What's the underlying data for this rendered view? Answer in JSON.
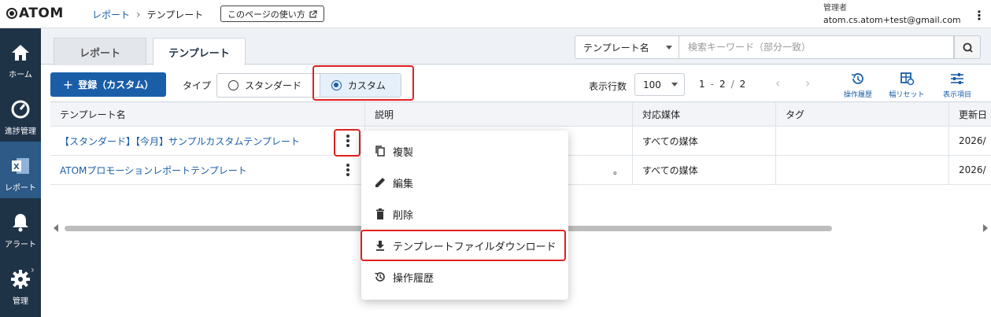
{
  "header": {
    "logo": "ATOM",
    "breadcrumb": [
      "レポート",
      "テンプレート"
    ],
    "help_button": "このページの使い方",
    "user_role": "管理者",
    "user_email": "atom.cs.atom+test@gmail.com"
  },
  "sidebar": {
    "items": [
      {
        "label": "ホーム",
        "icon": "home-icon"
      },
      {
        "label": "進捗管理",
        "icon": "gauge-icon"
      },
      {
        "label": "レポート",
        "icon": "excel-icon",
        "active": true
      },
      {
        "label": "アラート",
        "icon": "bell-icon"
      },
      {
        "label": "管理",
        "icon": "gear-icon"
      }
    ]
  },
  "tabs": [
    "レポート",
    "テンプレート"
  ],
  "search": {
    "field_select": "テンプレート名",
    "placeholder": "検索キーワード（部分一致）"
  },
  "toolbar": {
    "add_button": "登録（カスタム）",
    "type_label": "タイプ",
    "type_options": [
      "スタンダード",
      "カスタム"
    ],
    "selected_type": "カスタム",
    "rows_label": "表示行数",
    "rows_value": "100",
    "pager": {
      "from": "1",
      "to": "2",
      "total": "2"
    },
    "tools": [
      "操作履歴",
      "幅リセット",
      "表示項目"
    ]
  },
  "table": {
    "columns": [
      "テンプレート名",
      "説明",
      "対応媒体",
      "タグ",
      "更新日"
    ],
    "rows": [
      {
        "name": "【スタンダード】【今月】サンプルカスタムテンプレート",
        "desc": "",
        "media": "すべての媒体",
        "tag": "",
        "updated": "2026/"
      },
      {
        "name": "ATOMプロモーションレポートテンプレート",
        "desc": "。",
        "media": "すべての媒体",
        "tag": "",
        "updated": "2026/"
      }
    ]
  },
  "context_menu": {
    "items": [
      "複製",
      "編集",
      "削除",
      "テンプレートファイルダウンロード",
      "操作履歴"
    ]
  },
  "colors": {
    "accent": "#1a5ea8",
    "sidebar": "#1f3347",
    "highlight": "#e02020"
  }
}
